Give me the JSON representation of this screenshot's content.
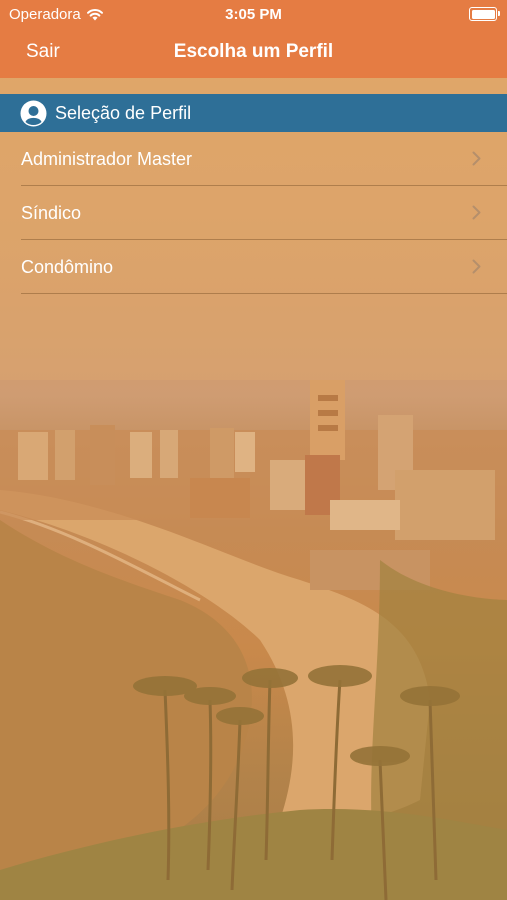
{
  "status_bar": {
    "carrier": "Operadora",
    "time": "3:05 PM"
  },
  "nav": {
    "back_label": "Sair",
    "title": "Escolha um Perfil"
  },
  "section": {
    "label": "Seleção de Perfil",
    "icon": "user-profile-icon"
  },
  "profiles": [
    {
      "label": "Administrador Master"
    },
    {
      "label": "Síndico"
    },
    {
      "label": "Condômino"
    }
  ],
  "colors": {
    "nav_background": "#e57c43",
    "section_background": "#2e6f97",
    "text": "#ffffff"
  }
}
